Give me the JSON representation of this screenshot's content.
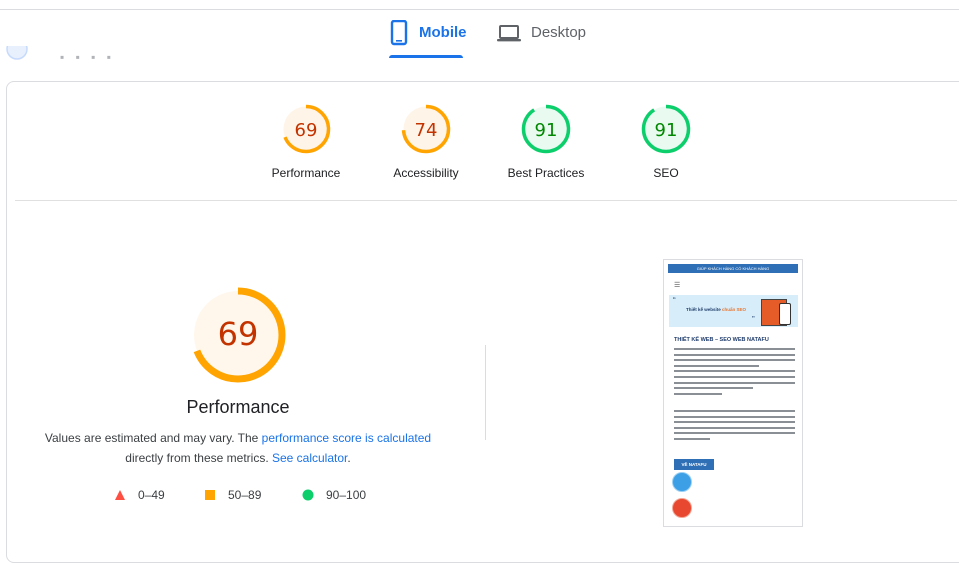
{
  "tabs": [
    {
      "label": "Mobile",
      "icon": "phone-icon",
      "active": true
    },
    {
      "label": "Desktop",
      "icon": "laptop-icon",
      "active": false
    }
  ],
  "colors": {
    "accent": "#1a73e8",
    "average": "#ffa400",
    "average_text": "#c33300",
    "good": "#0cce6b",
    "good_text": "#008800",
    "poor": "#ff4e42"
  },
  "scores": [
    {
      "value": "69",
      "label": "Performance",
      "status": "average",
      "fraction": 0.69
    },
    {
      "value": "74",
      "label": "Accessibility",
      "status": "average",
      "fraction": 0.74
    },
    {
      "value": "91",
      "label": "Best Practices",
      "status": "good",
      "fraction": 0.91
    },
    {
      "value": "91",
      "label": "SEO",
      "status": "good",
      "fraction": 0.91
    }
  ],
  "main": {
    "score": "69",
    "fraction": 0.69,
    "label": "Performance",
    "note_prefix": "Values are estimated and may vary. The ",
    "note_link1": "performance score is calculated",
    "note_mid": "directly from these metrics. ",
    "note_link2": "See calculator",
    "note_suffix": "."
  },
  "legend": [
    {
      "range": "0–49",
      "shape": "triangle",
      "color": "#ff4e42"
    },
    {
      "range": "50–89",
      "shape": "square",
      "color": "#ffa400"
    },
    {
      "range": "90–100",
      "shape": "circle",
      "color": "#0cce6b"
    }
  ],
  "screenshot": {
    "top_bar": "GIÚP KHÁCH HÀNG CÓ KHÁCH HÀNG",
    "banner_text": "Thiết kế website",
    "banner_highlight": "chuẩn SEO",
    "heading": "THIẾT KẾ WEB – SEO WEB NATAFU",
    "button": "VỀ NATAFU"
  }
}
